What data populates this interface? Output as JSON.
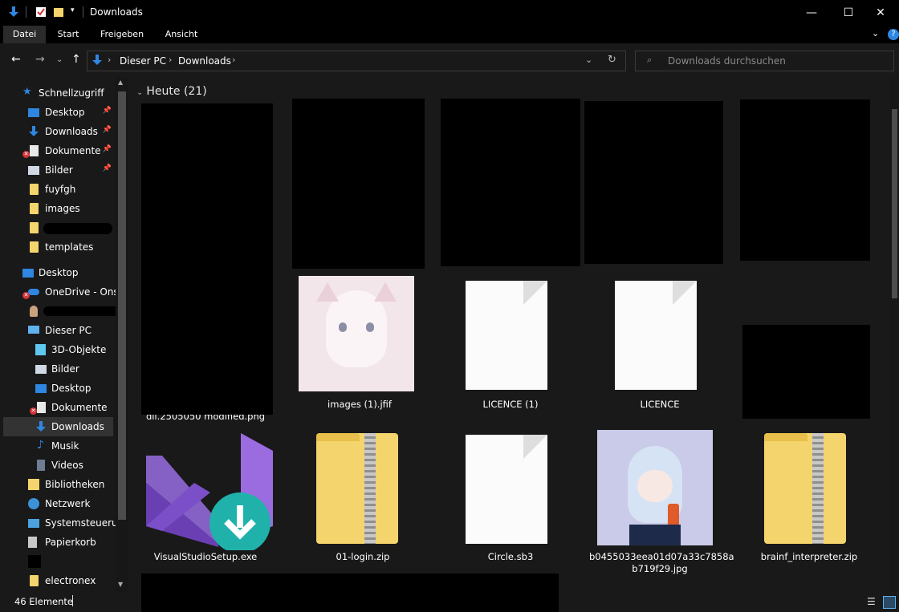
{
  "window": {
    "title": "Downloads"
  },
  "ribbon": {
    "tabs": [
      "Datei",
      "Start",
      "Freigeben",
      "Ansicht"
    ]
  },
  "address": {
    "crumbs": [
      "Dieser PC",
      "Downloads"
    ]
  },
  "search": {
    "placeholder": "Downloads durchsuchen"
  },
  "sidebar": {
    "items": [
      {
        "label": "Schnellzugriff"
      },
      {
        "label": "Desktop"
      },
      {
        "label": "Downloads"
      },
      {
        "label": "Dokumente"
      },
      {
        "label": "Bilder"
      },
      {
        "label": "fuyfgh"
      },
      {
        "label": "images"
      },
      {
        "label": ""
      },
      {
        "label": "templates"
      },
      {
        "label": "Desktop"
      },
      {
        "label": "OneDrive - Onsl"
      },
      {
        "label": ""
      },
      {
        "label": "Dieser PC"
      },
      {
        "label": "3D-Objekte"
      },
      {
        "label": "Bilder"
      },
      {
        "label": "Desktop"
      },
      {
        "label": "Dokumente"
      },
      {
        "label": "Downloads"
      },
      {
        "label": "Musik"
      },
      {
        "label": "Videos"
      },
      {
        "label": "Bibliotheken"
      },
      {
        "label": "Netzwerk"
      },
      {
        "label": "Systemsteuerung"
      },
      {
        "label": "Papierkorb"
      },
      {
        "label": ""
      },
      {
        "label": "electronex"
      }
    ]
  },
  "content": {
    "group_header": "Heute (21)",
    "files": [
      {
        "name": "dll.2505050 modified.png"
      },
      {
        "name": "images (1).jfif"
      },
      {
        "name": "LICENCE (1)"
      },
      {
        "name": "LICENCE"
      },
      {
        "name": "VisualStudioSetup.exe"
      },
      {
        "name": "01-login.zip"
      },
      {
        "name": "Circle.sb3"
      },
      {
        "name": "b0455033eea01d07a33c7858a b719f29.jpg"
      },
      {
        "name": "brainf_interpreter.zip"
      }
    ]
  },
  "status": {
    "count": "46 Elemente"
  },
  "colors": {
    "accent_blue": "#2f86e0",
    "folder_yellow": "#f4d46c",
    "vs_purple": "#8661c5",
    "vs_teal": "#20b2aa",
    "error_red": "#d13438"
  }
}
